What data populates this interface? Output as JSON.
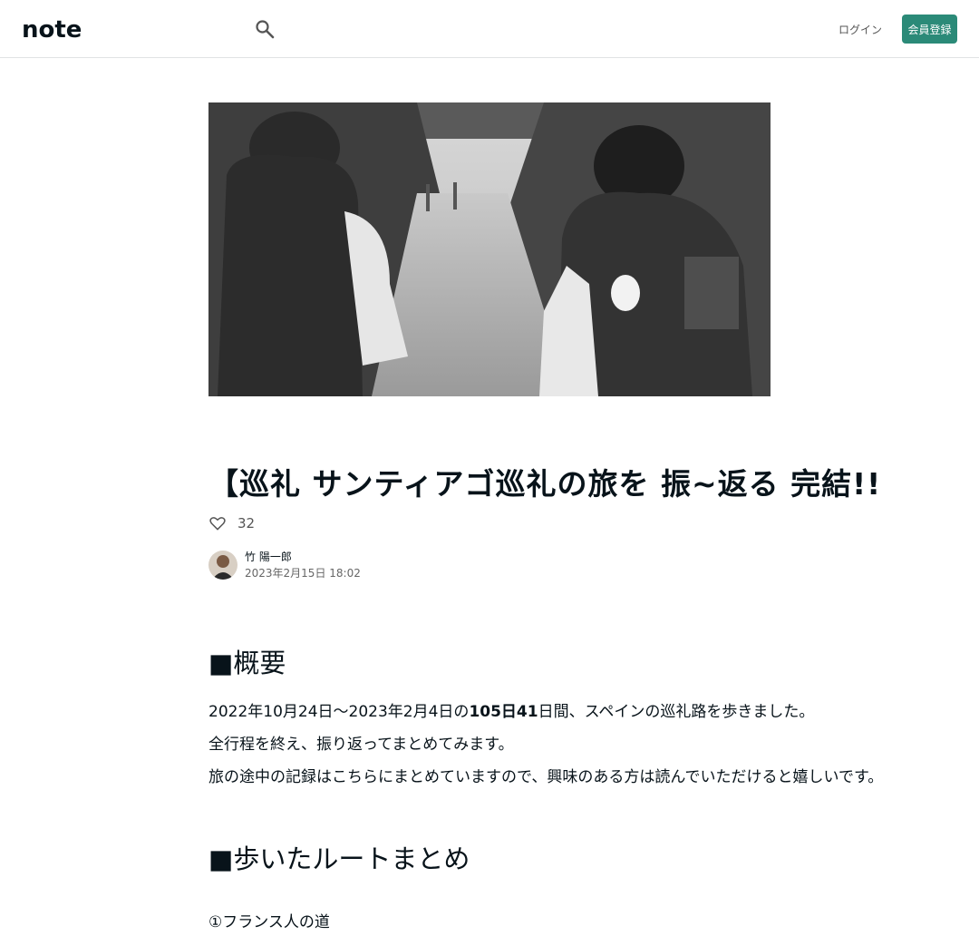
{
  "header": {
    "logo_text": "note",
    "search_icon": "search-icon",
    "login_label": "ログイン",
    "signup_label": "会員登録"
  },
  "colors": {
    "accent": "#2b8a78",
    "text": "#08131a",
    "muted": "#666666"
  },
  "hero": {
    "icon": "hiker-photo"
  },
  "article": {
    "title": "【巡礼 サンティアゴ巡礼の旅を 振~返る 完結!!",
    "like_count": "32",
    "author_name": "竹 陽一郎",
    "date": "2023年2月15日 18:02",
    "sections": [
      {
        "heading": "■概要",
        "para1_pre": "2022年10月24日〜2023年2月4日の",
        "para1_bold": "105日41",
        "para1_post": "日間、スペインの巡礼路を歩きました。",
        "para2": "全行程を終え、振り返ってまとめてみます。",
        "para3": "旅の途中の記録はこちらにまとめていますので、興味のある方は読んでいただけると嬉しいです。"
      },
      {
        "heading": "■歩いたルートまとめ",
        "item1": "①フランス人の道"
      }
    ]
  }
}
